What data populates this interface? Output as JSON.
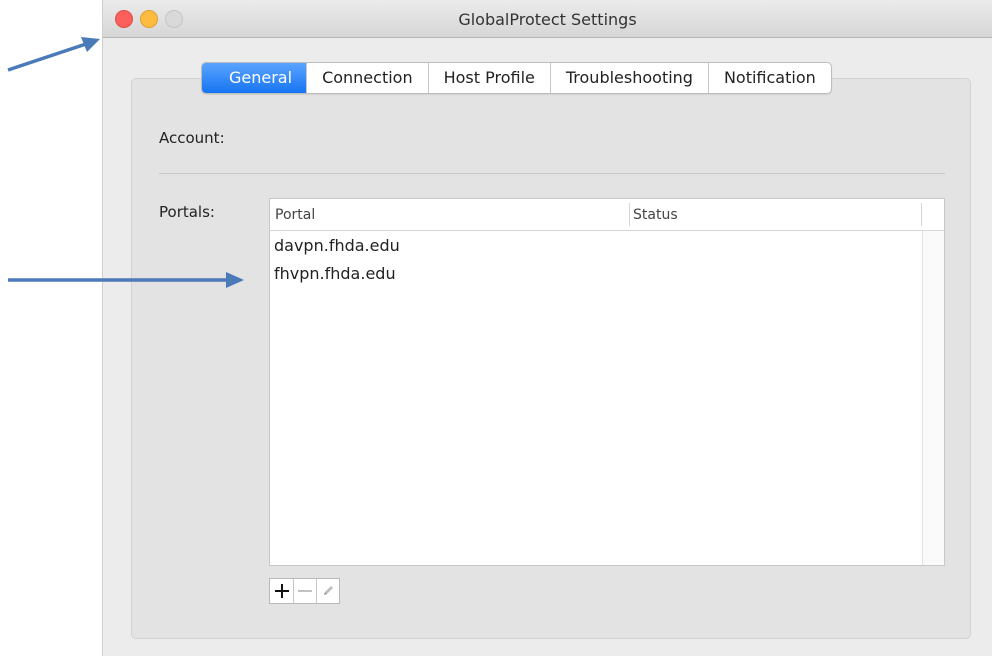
{
  "window": {
    "title": "GlobalProtect Settings"
  },
  "tabs": [
    {
      "label": "General",
      "active": true
    },
    {
      "label": "Connection",
      "active": false
    },
    {
      "label": "Host Profile",
      "active": false
    },
    {
      "label": "Troubleshooting",
      "active": false
    },
    {
      "label": "Notification",
      "active": false
    }
  ],
  "general": {
    "account_label": "Account:",
    "portals_label": "Portals:",
    "portals_table": {
      "columns": [
        "Portal",
        "Status"
      ],
      "rows": [
        {
          "portal": "davpn.fhda.edu",
          "status": ""
        },
        {
          "portal": "fhvpn.fhda.edu",
          "status": ""
        }
      ]
    },
    "actions": [
      {
        "icon": "plus-icon",
        "enabled": true
      },
      {
        "icon": "minus-icon",
        "enabled": false
      },
      {
        "icon": "pencil-icon",
        "enabled": false
      }
    ]
  },
  "colors": {
    "accent": "#1774f2",
    "annotation_arrow": "#4a7ab8",
    "close": "#fc605c",
    "minimize": "#fdbc40"
  }
}
